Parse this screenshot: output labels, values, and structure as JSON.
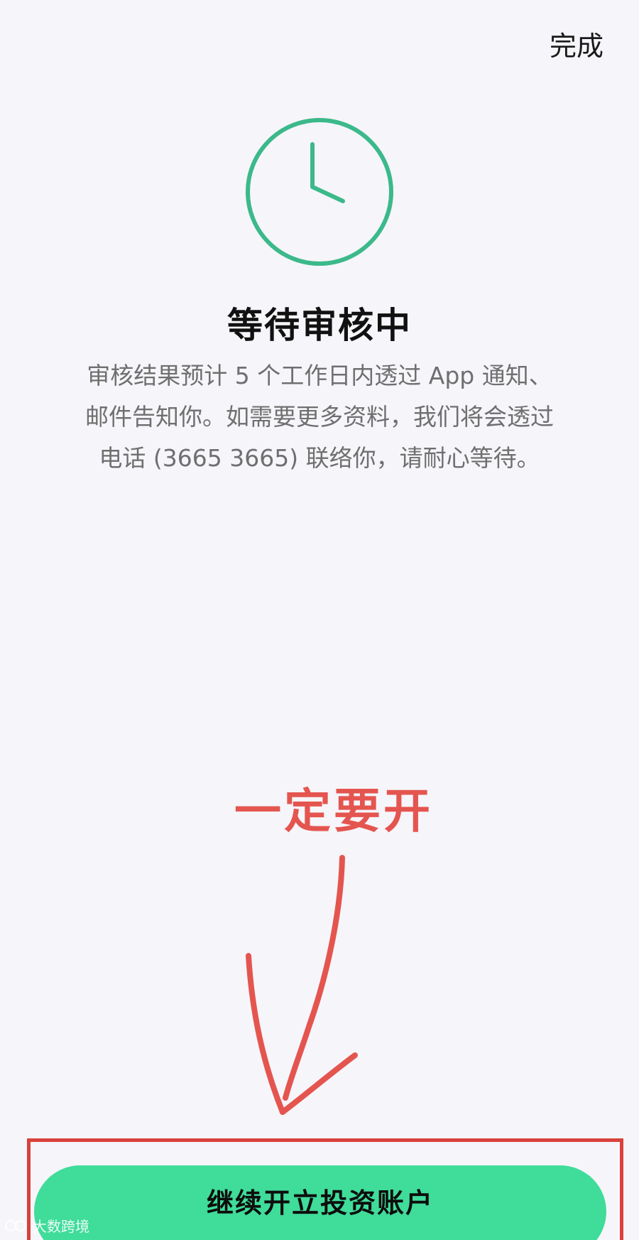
{
  "header": {
    "done_label": "完成"
  },
  "status": {
    "icon": "clock-icon",
    "accent_color": "#3cb98a",
    "title": "等待审核中",
    "description": "审核结果预计 5 个工作日内透过 App 通知、邮件告知你。如需要更多资料，我们将会透过电话 (3665 3665) 联络你，请耐心等待。"
  },
  "annotation": {
    "text": "一定要开",
    "color": "#e4554f",
    "arrow_icon": "hand-drawn-arrow-icon"
  },
  "cta": {
    "label": "继续开立投资账户",
    "color": "#3fdc9a"
  },
  "watermark": {
    "logo": "watermark-logo-icon",
    "text": "大数跨境"
  }
}
